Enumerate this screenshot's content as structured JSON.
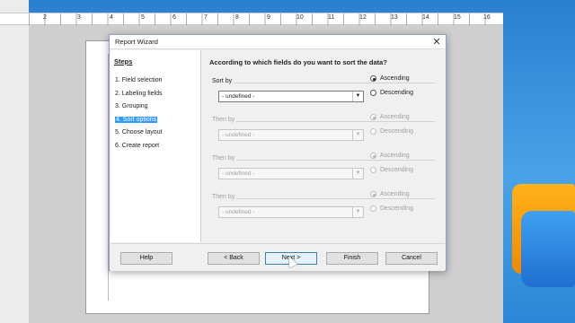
{
  "ruler": {
    "numbers": [
      "2",
      "3",
      "4",
      "5",
      "6",
      "7",
      "8",
      "9",
      "10",
      "11",
      "12",
      "13",
      "14",
      "15",
      "16"
    ]
  },
  "dialog": {
    "title": "Report Wizard",
    "close_icon": "close-icon",
    "steps_heading": "Steps",
    "steps": [
      {
        "label": "1. Field selection",
        "active": false
      },
      {
        "label": "2. Labeling fields",
        "active": false
      },
      {
        "label": "3. Grouping",
        "active": false
      },
      {
        "label": "4. Sort options",
        "active": true
      },
      {
        "label": "5. Choose layout",
        "active": false
      },
      {
        "label": "6. Create report",
        "active": false
      }
    ],
    "question": "According to which fields do you want to sort the data?",
    "sort_groups": [
      {
        "label": "Sort by",
        "value": "- undefined -",
        "ascending": "Ascending",
        "descending": "Descending",
        "selected": "Ascending",
        "enabled": true
      },
      {
        "label": "Then by",
        "value": "- undefined -",
        "ascending": "Ascending",
        "descending": "Descending",
        "selected": "Ascending",
        "enabled": false
      },
      {
        "label": "Then by",
        "value": "- undefined -",
        "ascending": "Ascending",
        "descending": "Descending",
        "selected": "Ascending",
        "enabled": false
      },
      {
        "label": "Then by",
        "value": "- undefined -",
        "ascending": "Ascending",
        "descending": "Descending",
        "selected": "Ascending",
        "enabled": false
      }
    ],
    "buttons": {
      "help": "Help",
      "back": "< Back",
      "next": "Next >",
      "finish": "Finish",
      "cancel": "Cancel"
    }
  }
}
